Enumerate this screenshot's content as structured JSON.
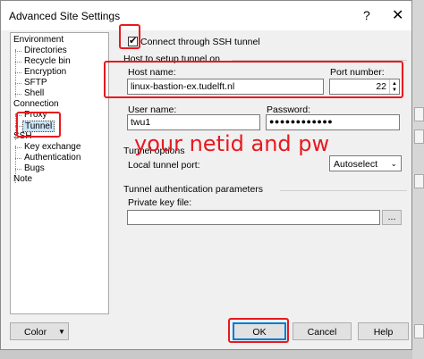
{
  "window": {
    "title": "Advanced Site Settings",
    "help_glyph": "?",
    "close_glyph": "✕"
  },
  "tree": {
    "items": [
      {
        "label": "Environment"
      },
      {
        "label": "Directories"
      },
      {
        "label": "Recycle bin"
      },
      {
        "label": "Encryption"
      },
      {
        "label": "SFTP"
      },
      {
        "label": "Shell"
      },
      {
        "label": "Connection"
      },
      {
        "label": "Proxy"
      },
      {
        "label": "Tunnel"
      },
      {
        "label": "SSH"
      },
      {
        "label": "Key exchange"
      },
      {
        "label": "Authentication"
      },
      {
        "label": "Bugs"
      },
      {
        "label": "Note"
      }
    ]
  },
  "tunnel": {
    "connect_checkbox_label": "Connect through SSH tunnel",
    "connect_checked": true,
    "host_group_title": "Host to setup tunnel on",
    "host_name_label": "Host name:",
    "host_name_value": "linux-bastion-ex.tudelft.nl",
    "port_label": "Port number:",
    "port_value": "22",
    "user_label": "User name:",
    "user_value": "twu1",
    "password_label": "Password:",
    "password_value": "●●●●●●●●●●●●",
    "options_group_title": "Tunnel options",
    "local_port_label": "Local tunnel port:",
    "local_port_value": "Autoselect",
    "auth_group_title": "Tunnel authentication parameters",
    "private_key_label": "Private key file:",
    "private_key_value": "",
    "browse_label": "..."
  },
  "annotation": {
    "text": "your netid and pw"
  },
  "buttons": {
    "color": "Color",
    "ok": "OK",
    "cancel": "Cancel",
    "help": "Help"
  },
  "colors": {
    "highlight": "#e8191f",
    "selection": "#cce4f7",
    "accent": "#0078d7"
  }
}
